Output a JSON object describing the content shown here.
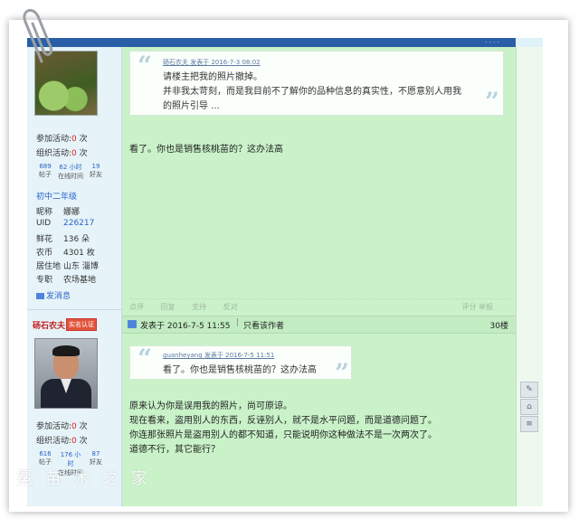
{
  "header": {
    "tabs_label": "· · · ·"
  },
  "sidebar_user1": {
    "activities_join_label": "参加活动:",
    "activities_join_count": "0",
    "activities_join_unit": "次",
    "activities_org_label": "组织活动:",
    "activities_org_count": "0",
    "activities_org_unit": "次",
    "stats": [
      {
        "num": "689",
        "label": "帖子"
      },
      {
        "num": "62 小时",
        "label": "在线时间"
      },
      {
        "num": "19",
        "label": "好友"
      }
    ],
    "rank": "初中二年级",
    "profile": [
      {
        "k": "昵称",
        "v": "娜娜"
      },
      {
        "k": "UID",
        "v": "226217"
      },
      {
        "k": "鲜花",
        "v": "136 朵"
      },
      {
        "k": "农币",
        "v": "4301 枚"
      },
      {
        "k": "居住地",
        "v": "山东 淄博"
      },
      {
        "k": "专职",
        "v": "农场基地"
      }
    ],
    "pm_label": "发消息"
  },
  "sidebar_user2": {
    "name": "砀石农夫",
    "badge": "实名认证",
    "activities_join_label": "参加活动:",
    "activities_join_count": "0",
    "activities_join_unit": "次",
    "activities_org_label": "组织活动:",
    "activities_org_count": "0",
    "activities_org_unit": "次",
    "stats": [
      {
        "num": "616",
        "label": "帖子"
      },
      {
        "num": "176 小时",
        "label": "在线时间"
      },
      {
        "num": "87",
        "label": "好友"
      }
    ]
  },
  "post1": {
    "quote_meta": "砀石农夫 发表于 2016-7-3 08:02",
    "quote_lines": [
      "请楼主把我的照片撤掉。",
      "并非我太苛刻，而是我目前不了解你的品种信息的真实性，不愿意别人用我",
      "的照片引导 ..."
    ],
    "reply": "看了。你也是销售核桃苗的？这办法高",
    "actions": [
      "点评",
      "回复",
      "支持",
      "反对"
    ],
    "actions_right": "评分  举报"
  },
  "post2": {
    "posted": "发表于 2016-7-5 11:55",
    "author_only": "只看该作者",
    "floor": "30楼",
    "quote_meta": "guanheyang 发表于 2016-7-5 11:51",
    "quote_line": "看了。你也是销售核桃苗的？这办法高",
    "reply_lines": [
      "原来认为你是误用我的照片，尚可原谅。",
      "现在看来，盗用别人的东西，反诬别人，就不是水平问题，而是道德问题了。",
      "你连那张照片是盗用别人的都不知道，只能说明你这种做法不是一次两次了。",
      "道德不行，其它能行？"
    ]
  },
  "right_tools": [
    "✎",
    "⌂",
    "≡"
  ],
  "watermark": "冕 苗 木 之 家"
}
